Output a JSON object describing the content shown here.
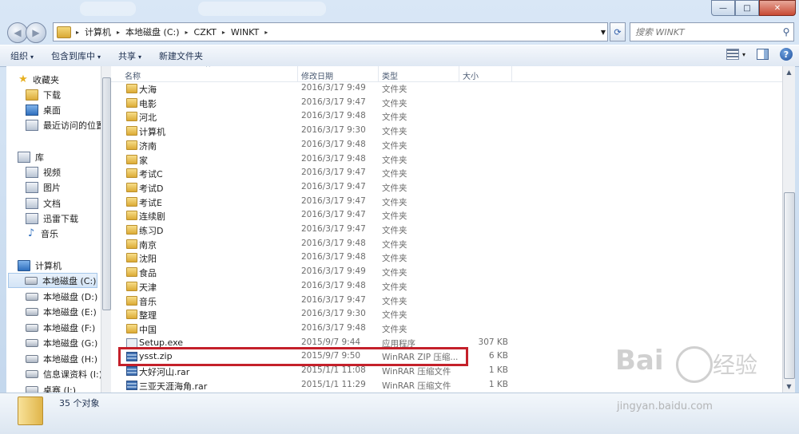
{
  "window": {
    "min_glyph": "—",
    "max_glyph": "□",
    "close_glyph": "✕"
  },
  "address": {
    "segments": [
      "计算机",
      "本地磁盘 (C:)",
      "CZKT",
      "WINKT"
    ]
  },
  "search": {
    "placeholder": "搜索 WINKT"
  },
  "toolbar": {
    "organize": "组织",
    "include_in_library": "包含到库中",
    "share": "共享",
    "new_folder": "新建文件夹"
  },
  "nav": {
    "favorites": "收藏夹",
    "downloads": "下载",
    "desktop": "桌面",
    "recent": "最近访问的位置",
    "libraries": "库",
    "videos": "视频",
    "pictures": "图片",
    "documents": "文档",
    "thunder": "迅雷下载",
    "music": "音乐",
    "computer": "计算机",
    "drive_c": "本地磁盘 (C:)",
    "drive_d": "本地磁盘 (D:)",
    "drive_e": "本地磁盘 (E:)",
    "drive_f": "本地磁盘 (F:)",
    "drive_g": "本地磁盘 (G:)",
    "drive_h": "本地磁盘 (H:)",
    "drive_i": "信息课资料 (I:)",
    "drive_j": "桌赛 (J:)"
  },
  "columns": {
    "name": "名称",
    "modified": "修改日期",
    "type": "类型",
    "size": "大小"
  },
  "files": [
    {
      "name": "大海",
      "date": "2016/3/17 9:49",
      "type": "文件夹",
      "size": "",
      "kind": "folder"
    },
    {
      "name": "电影",
      "date": "2016/3/17 9:47",
      "type": "文件夹",
      "size": "",
      "kind": "folder"
    },
    {
      "name": "河北",
      "date": "2016/3/17 9:48",
      "type": "文件夹",
      "size": "",
      "kind": "folder"
    },
    {
      "name": "计算机",
      "date": "2016/3/17 9:30",
      "type": "文件夹",
      "size": "",
      "kind": "folder"
    },
    {
      "name": "济南",
      "date": "2016/3/17 9:48",
      "type": "文件夹",
      "size": "",
      "kind": "folder"
    },
    {
      "name": "家",
      "date": "2016/3/17 9:48",
      "type": "文件夹",
      "size": "",
      "kind": "folder"
    },
    {
      "name": "考试C",
      "date": "2016/3/17 9:47",
      "type": "文件夹",
      "size": "",
      "kind": "folder"
    },
    {
      "name": "考试D",
      "date": "2016/3/17 9:47",
      "type": "文件夹",
      "size": "",
      "kind": "folder"
    },
    {
      "name": "考试E",
      "date": "2016/3/17 9:47",
      "type": "文件夹",
      "size": "",
      "kind": "folder"
    },
    {
      "name": "连续剧",
      "date": "2016/3/17 9:47",
      "type": "文件夹",
      "size": "",
      "kind": "folder"
    },
    {
      "name": "练习D",
      "date": "2016/3/17 9:47",
      "type": "文件夹",
      "size": "",
      "kind": "folder"
    },
    {
      "name": "南京",
      "date": "2016/3/17 9:48",
      "type": "文件夹",
      "size": "",
      "kind": "folder"
    },
    {
      "name": "沈阳",
      "date": "2016/3/17 9:48",
      "type": "文件夹",
      "size": "",
      "kind": "folder"
    },
    {
      "name": "食品",
      "date": "2016/3/17 9:49",
      "type": "文件夹",
      "size": "",
      "kind": "folder"
    },
    {
      "name": "天津",
      "date": "2016/3/17 9:48",
      "type": "文件夹",
      "size": "",
      "kind": "folder"
    },
    {
      "name": "音乐",
      "date": "2016/3/17 9:47",
      "type": "文件夹",
      "size": "",
      "kind": "folder"
    },
    {
      "name": "整理",
      "date": "2016/3/17 9:30",
      "type": "文件夹",
      "size": "",
      "kind": "folder"
    },
    {
      "name": "中国",
      "date": "2016/3/17 9:48",
      "type": "文件夹",
      "size": "",
      "kind": "folder"
    },
    {
      "name": "Setup.exe",
      "date": "2015/9/7 9:44",
      "type": "应用程序",
      "size": "307 KB",
      "kind": "exe"
    },
    {
      "name": "ysst.zip",
      "date": "2015/9/7 9:50",
      "type": "WinRAR ZIP 压缩...",
      "size": "6 KB",
      "kind": "rar"
    },
    {
      "name": "大好河山.rar",
      "date": "2015/1/1 11:08",
      "type": "WinRAR 压缩文件",
      "size": "1 KB",
      "kind": "rar"
    },
    {
      "name": "三亚天涯海角.rar",
      "date": "2015/1/1 11:29",
      "type": "WinRAR 压缩文件",
      "size": "1 KB",
      "kind": "rar"
    }
  ],
  "status": {
    "count": "35 个对象"
  },
  "watermark": {
    "logo": "Bai",
    "logo_tail": "经验",
    "url": "jingyan.baidu.com"
  }
}
